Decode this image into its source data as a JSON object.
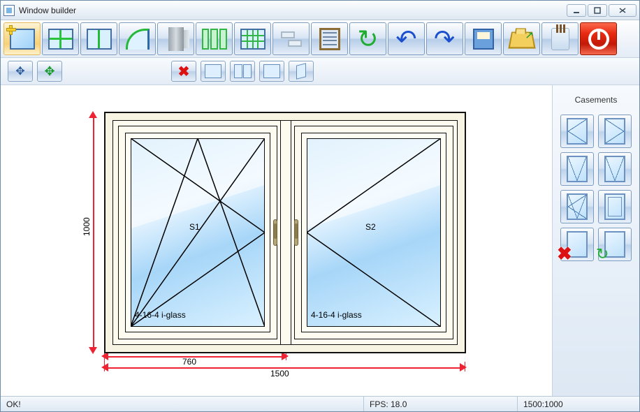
{
  "window": {
    "title": "Window builder",
    "faded": "",
    "faded2": ""
  },
  "toolbar": {
    "items": [
      "new-window",
      "split-horizontal",
      "split-vertical",
      "arc-shape",
      "profile",
      "multi-door",
      "grid-muntins",
      "corner-join",
      "properties-list",
      "refresh",
      "undo",
      "redo",
      "save",
      "open",
      "styles",
      "power"
    ]
  },
  "toolbar2": {
    "items": [
      "measure-move",
      "move-free",
      "delete",
      "dimension-edit",
      "align-windows",
      "zoom-area",
      "mirror"
    ]
  },
  "side_panel": {
    "title": "Casements",
    "items": [
      "open-left",
      "open-right",
      "tilt-1",
      "tilt-2",
      "tilt-turn",
      "fixed",
      "remove-casement",
      "reset-casement"
    ]
  },
  "drawing": {
    "height_label": "1000",
    "width_total_label": "1500",
    "width_left_label": "760",
    "sash_left_label": "S1",
    "sash_right_label": "S2",
    "glass_spec": "4-16-4 i-glass"
  },
  "status": {
    "ok": "OK!",
    "fps_label": "FPS: 18.0",
    "dims": "1500:1000"
  }
}
